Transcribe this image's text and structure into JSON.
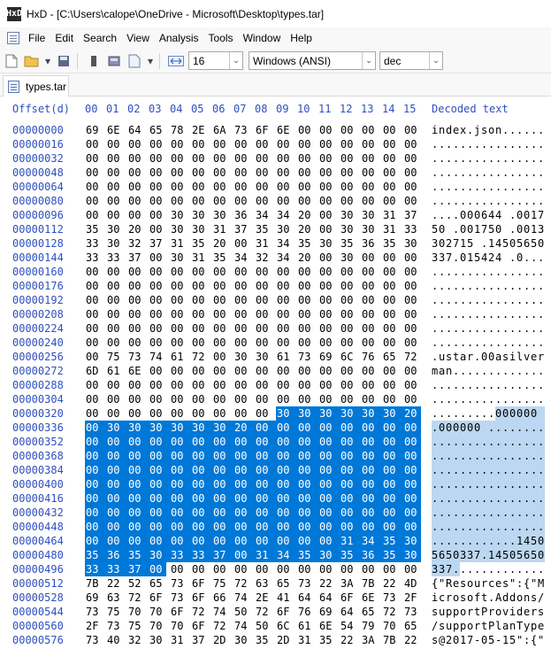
{
  "window": {
    "app_icon_text": "HxD",
    "title": "HxD - [C:\\Users\\calope\\OneDrive - Microsoft\\Desktop\\types.tar]"
  },
  "menu": [
    "File",
    "Edit",
    "Search",
    "View",
    "Analysis",
    "Tools",
    "Window",
    "Help"
  ],
  "toolbar": {
    "bytes_per_row": "16",
    "charset": "Windows (ANSI)",
    "offset_base": "dec"
  },
  "tab": {
    "label": "types.tar"
  },
  "hex": {
    "offset_header": "Offset(d)",
    "columns": [
      "00",
      "01",
      "02",
      "03",
      "04",
      "05",
      "06",
      "07",
      "08",
      "09",
      "10",
      "11",
      "12",
      "13",
      "14",
      "15"
    ],
    "decoded_header": "Decoded text",
    "selection": {
      "start": 329,
      "end": 499
    },
    "rows": [
      {
        "offset": "00000000",
        "bytes": "69 6E 64 65 78 2E 6A 73 6F 6E 00 00 00 00 00 00",
        "text": "index.json......"
      },
      {
        "offset": "00000016",
        "bytes": "00 00 00 00 00 00 00 00 00 00 00 00 00 00 00 00",
        "text": "................"
      },
      {
        "offset": "00000032",
        "bytes": "00 00 00 00 00 00 00 00 00 00 00 00 00 00 00 00",
        "text": "................"
      },
      {
        "offset": "00000048",
        "bytes": "00 00 00 00 00 00 00 00 00 00 00 00 00 00 00 00",
        "text": "................"
      },
      {
        "offset": "00000064",
        "bytes": "00 00 00 00 00 00 00 00 00 00 00 00 00 00 00 00",
        "text": "................"
      },
      {
        "offset": "00000080",
        "bytes": "00 00 00 00 00 00 00 00 00 00 00 00 00 00 00 00",
        "text": "................"
      },
      {
        "offset": "00000096",
        "bytes": "00 00 00 00 30 30 30 36 34 34 20 00 30 30 31 37",
        "text": "....000644 .0017"
      },
      {
        "offset": "00000112",
        "bytes": "35 30 20 00 30 30 31 37 35 30 20 00 30 30 31 33",
        "text": "50 .001750 .0013"
      },
      {
        "offset": "00000128",
        "bytes": "33 30 32 37 31 35 20 00 31 34 35 30 35 36 35 30",
        "text": "302715 .14505650"
      },
      {
        "offset": "00000144",
        "bytes": "33 33 37 00 30 31 35 34 32 34 20 00 30 00 00 00",
        "text": "337.015424 .0..."
      },
      {
        "offset": "00000160",
        "bytes": "00 00 00 00 00 00 00 00 00 00 00 00 00 00 00 00",
        "text": "................"
      },
      {
        "offset": "00000176",
        "bytes": "00 00 00 00 00 00 00 00 00 00 00 00 00 00 00 00",
        "text": "................"
      },
      {
        "offset": "00000192",
        "bytes": "00 00 00 00 00 00 00 00 00 00 00 00 00 00 00 00",
        "text": "................"
      },
      {
        "offset": "00000208",
        "bytes": "00 00 00 00 00 00 00 00 00 00 00 00 00 00 00 00",
        "text": "................"
      },
      {
        "offset": "00000224",
        "bytes": "00 00 00 00 00 00 00 00 00 00 00 00 00 00 00 00",
        "text": "................"
      },
      {
        "offset": "00000240",
        "bytes": "00 00 00 00 00 00 00 00 00 00 00 00 00 00 00 00",
        "text": "................"
      },
      {
        "offset": "00000256",
        "bytes": "00 75 73 74 61 72 00 30 30 61 73 69 6C 76 65 72",
        "text": ".ustar.00asilver"
      },
      {
        "offset": "00000272",
        "bytes": "6D 61 6E 00 00 00 00 00 00 00 00 00 00 00 00 00",
        "text": "man............."
      },
      {
        "offset": "00000288",
        "bytes": "00 00 00 00 00 00 00 00 00 00 00 00 00 00 00 00",
        "text": "................"
      },
      {
        "offset": "00000304",
        "bytes": "00 00 00 00 00 00 00 00 00 00 00 00 00 00 00 00",
        "text": "................"
      },
      {
        "offset": "00000320",
        "bytes": "00 00 00 00 00 00 00 00 00 30 30 30 30 30 30 20",
        "text": ".........000000 "
      },
      {
        "offset": "00000336",
        "bytes": "00 30 30 30 30 30 30 20 00 00 00 00 00 00 00 00",
        "text": ".000000 ........"
      },
      {
        "offset": "00000352",
        "bytes": "00 00 00 00 00 00 00 00 00 00 00 00 00 00 00 00",
        "text": "................"
      },
      {
        "offset": "00000368",
        "bytes": "00 00 00 00 00 00 00 00 00 00 00 00 00 00 00 00",
        "text": "................"
      },
      {
        "offset": "00000384",
        "bytes": "00 00 00 00 00 00 00 00 00 00 00 00 00 00 00 00",
        "text": "................"
      },
      {
        "offset": "00000400",
        "bytes": "00 00 00 00 00 00 00 00 00 00 00 00 00 00 00 00",
        "text": "................"
      },
      {
        "offset": "00000416",
        "bytes": "00 00 00 00 00 00 00 00 00 00 00 00 00 00 00 00",
        "text": "................"
      },
      {
        "offset": "00000432",
        "bytes": "00 00 00 00 00 00 00 00 00 00 00 00 00 00 00 00",
        "text": "................"
      },
      {
        "offset": "00000448",
        "bytes": "00 00 00 00 00 00 00 00 00 00 00 00 00 00 00 00",
        "text": "................"
      },
      {
        "offset": "00000464",
        "bytes": "00 00 00 00 00 00 00 00 00 00 00 00 31 34 35 30",
        "text": "............1450"
      },
      {
        "offset": "00000480",
        "bytes": "35 36 35 30 33 33 37 00 31 34 35 30 35 36 35 30",
        "text": "5650337.14505650"
      },
      {
        "offset": "00000496",
        "bytes": "33 33 37 00 00 00 00 00 00 00 00 00 00 00 00 00",
        "text": "337............."
      },
      {
        "offset": "00000512",
        "bytes": "7B 22 52 65 73 6F 75 72 63 65 73 22 3A 7B 22 4D",
        "text": "{\"Resources\":{\"M"
      },
      {
        "offset": "00000528",
        "bytes": "69 63 72 6F 73 6F 66 74 2E 41 64 64 6F 6E 73 2F",
        "text": "icrosoft.Addons/"
      },
      {
        "offset": "00000544",
        "bytes": "73 75 70 70 6F 72 74 50 72 6F 76 69 64 65 72 73",
        "text": "supportProviders"
      },
      {
        "offset": "00000560",
        "bytes": "2F 73 75 70 70 6F 72 74 50 6C 61 6E 54 79 70 65",
        "text": "/supportPlanType"
      },
      {
        "offset": "00000576",
        "bytes": "73 40 32 30 31 37 2D 30 35 2D 31 35 22 3A 7B 22",
        "text": "s@2017-05-15\":{\""
      }
    ]
  }
}
